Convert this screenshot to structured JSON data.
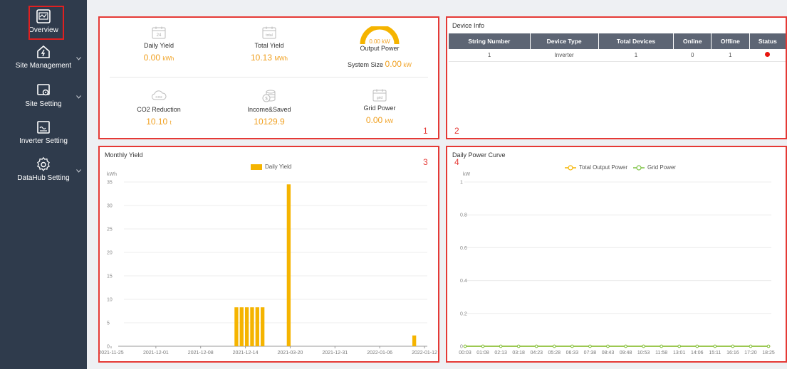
{
  "sidebar": {
    "items": [
      {
        "label": "Overview",
        "icon": "overview-icon",
        "active": true
      },
      {
        "label": "Site Management",
        "icon": "site-management-icon"
      },
      {
        "label": "Site Setting",
        "icon": "site-setting-icon"
      },
      {
        "label": "Inverter Setting",
        "icon": "inverter-setting-icon"
      },
      {
        "label": "DataHub Setting",
        "icon": "datahub-setting-icon"
      }
    ]
  },
  "summary": {
    "marker": "1",
    "daily_yield": {
      "label": "Daily Yield",
      "value": "0.00",
      "unit": "kWh",
      "icon_text": "24"
    },
    "total_yield": {
      "label": "Total Yield",
      "value": "10.13",
      "unit": "MWh",
      "icon_text": "total"
    },
    "output_power": {
      "label": "Output Power",
      "gauge_value": "0.00",
      "gauge_unit": "kW",
      "system_size_label": "System Size",
      "system_size_value": "0.00",
      "system_size_unit": "kW"
    },
    "co2": {
      "label": "CO2 Reduction",
      "value": "10.10",
      "unit": "t",
      "icon_text": "CO2"
    },
    "income": {
      "label": "Income&Saved",
      "value": "10129.9"
    },
    "grid_power": {
      "label": "Grid Power",
      "value": "0.00",
      "unit": "kW",
      "icon_text": "grid"
    }
  },
  "device_info": {
    "title": "Device Info",
    "marker": "2",
    "columns": [
      "String Number",
      "Device Type",
      "Total Devices",
      "Online",
      "Offline",
      "Status"
    ],
    "rows": [
      {
        "string_number": "1",
        "device_type": "Inverter",
        "total": "1",
        "online": "0",
        "offline": "1",
        "status_color": "#e8160f"
      }
    ]
  },
  "monthly_yield": {
    "title": "Monthly Yield",
    "marker": "3"
  },
  "daily_power": {
    "title": "Daily Power Curve",
    "marker": "4"
  },
  "colors": {
    "accent": "#f0a020",
    "bar": "#f5b400",
    "line_output": "#f5b400",
    "line_grid": "#7cc242",
    "sidebar": "#2f3b4c",
    "alert_border": "#e53935"
  },
  "chart_data": [
    {
      "type": "bar",
      "title": "Monthly Yield",
      "ylabel": "kWh",
      "ylim": [
        0,
        35
      ],
      "yticks": [
        0,
        5,
        10,
        15,
        20,
        25,
        30,
        35
      ],
      "xticks": [
        "2021-11-25",
        "2021-12-01",
        "2021-12-08",
        "2021-12-14",
        "2021-03-20",
        "2021-12-31",
        "2022-01-06",
        "2022-01-12"
      ],
      "grid": true,
      "legend": "top-center",
      "series": [
        {
          "name": "Daily Yield",
          "color": "#f5b400",
          "points": [
            {
              "slot": 21,
              "value": 8.3
            },
            {
              "slot": 22,
              "value": 8.3
            },
            {
              "slot": 23,
              "value": 8.3
            },
            {
              "slot": 24,
              "value": 8.3
            },
            {
              "slot": 25,
              "value": 8.3
            },
            {
              "slot": 26,
              "value": 8.3
            },
            {
              "slot": 31,
              "value": 34.5
            },
            {
              "slot": 55,
              "value": 2.3
            }
          ]
        }
      ],
      "slot_count": 58
    },
    {
      "type": "line",
      "title": "Daily Power Curve",
      "ylabel": "kW",
      "ylim": [
        0,
        1
      ],
      "yticks": [
        0,
        0.2,
        0.4,
        0.6,
        0.8,
        1
      ],
      "x": [
        "00:03",
        "01:08",
        "02:13",
        "03:18",
        "04:23",
        "05:28",
        "06:33",
        "07:38",
        "08:43",
        "09:48",
        "10:53",
        "11:58",
        "13:01",
        "14:06",
        "15:11",
        "16:16",
        "17:20",
        "18:25"
      ],
      "grid": true,
      "legend": "top-center",
      "series": [
        {
          "name": "Total Output Power",
          "color": "#f5b400",
          "values": [
            0,
            0,
            0,
            0,
            0,
            0,
            0,
            0,
            0,
            0,
            0,
            0,
            0,
            0,
            0,
            0,
            0,
            0
          ]
        },
        {
          "name": "Grid Power",
          "color": "#7cc242",
          "values": [
            0,
            0,
            0,
            0,
            0,
            0,
            0,
            0,
            0,
            0,
            0,
            0,
            0,
            0,
            0,
            0,
            0,
            0
          ]
        }
      ]
    }
  ]
}
